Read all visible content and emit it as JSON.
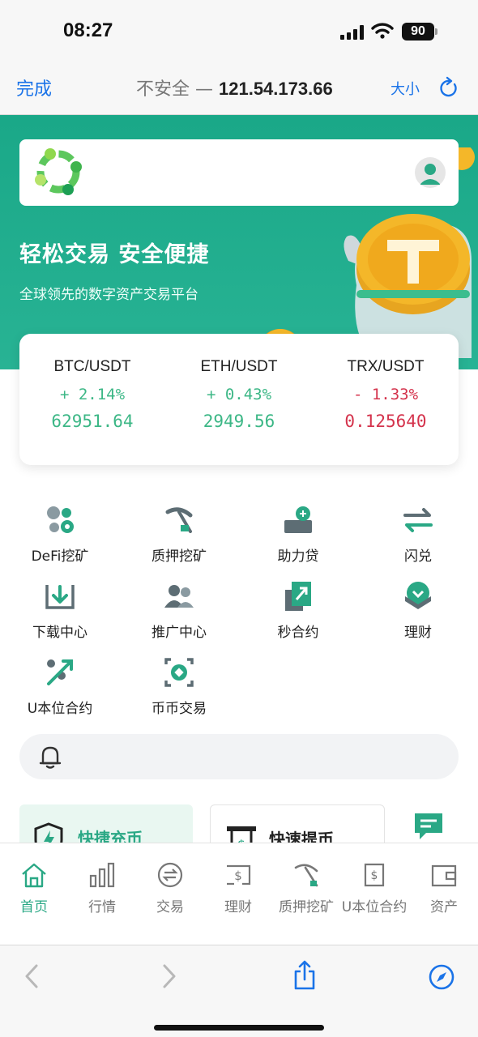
{
  "status_bar": {
    "time": "08:27",
    "battery": "90"
  },
  "browser": {
    "done_label": "完成",
    "security_label": "不安全 —",
    "url": "121.54.173.66",
    "text_size_label": "大小"
  },
  "hero": {
    "title": "轻松交易 安全便捷",
    "subtitle": "全球领先的数字资产交易平台"
  },
  "market": [
    {
      "pair": "BTC/USDT",
      "change": "+ 2.14%",
      "price": "62951.64",
      "trend": "up"
    },
    {
      "pair": "ETH/USDT",
      "change": "+ 0.43%",
      "price": "2949.56",
      "trend": "up"
    },
    {
      "pair": "TRX/USDT",
      "change": "- 1.33%",
      "price": "0.125640",
      "trend": "down"
    }
  ],
  "features": [
    {
      "label": "DeFi挖矿",
      "icon": "defi-mining-icon"
    },
    {
      "label": "质押挖矿",
      "icon": "pickaxe-icon"
    },
    {
      "label": "助力贷",
      "icon": "loan-icon"
    },
    {
      "label": "闪兑",
      "icon": "swap-arrows-icon"
    },
    {
      "label": "下载中心",
      "icon": "download-icon"
    },
    {
      "label": "推广中心",
      "icon": "users-icon"
    },
    {
      "label": "秒合约",
      "icon": "contract-icon"
    },
    {
      "label": "理财",
      "icon": "finance-icon"
    },
    {
      "label": "U本位合约",
      "icon": "percent-trend-icon"
    },
    {
      "label": "币币交易",
      "icon": "coin-exchange-icon"
    }
  ],
  "quick_actions": [
    {
      "label": "快捷充币",
      "icon": "shield-bolt-icon"
    },
    {
      "label": "快速提币",
      "icon": "withdraw-receipt-icon"
    }
  ],
  "bottom_nav": [
    {
      "label": "首页",
      "icon": "home-icon",
      "active": true
    },
    {
      "label": "行情",
      "icon": "bar-chart-icon",
      "active": false
    },
    {
      "label": "交易",
      "icon": "trade-icon",
      "active": false
    },
    {
      "label": "理财",
      "icon": "dollar-card-icon",
      "active": false
    },
    {
      "label": "质押挖矿",
      "icon": "pickaxe-icon",
      "active": false
    },
    {
      "label": "U本位合约",
      "icon": "dollar-exchange-icon",
      "active": false
    },
    {
      "label": "资产",
      "icon": "wallet-icon",
      "active": false
    }
  ],
  "colors": {
    "brand_green": "#2aa885",
    "hero_green": "#1aa888",
    "up": "#3cb786",
    "down": "#d4334c",
    "ios_blue": "#1a73e8"
  }
}
